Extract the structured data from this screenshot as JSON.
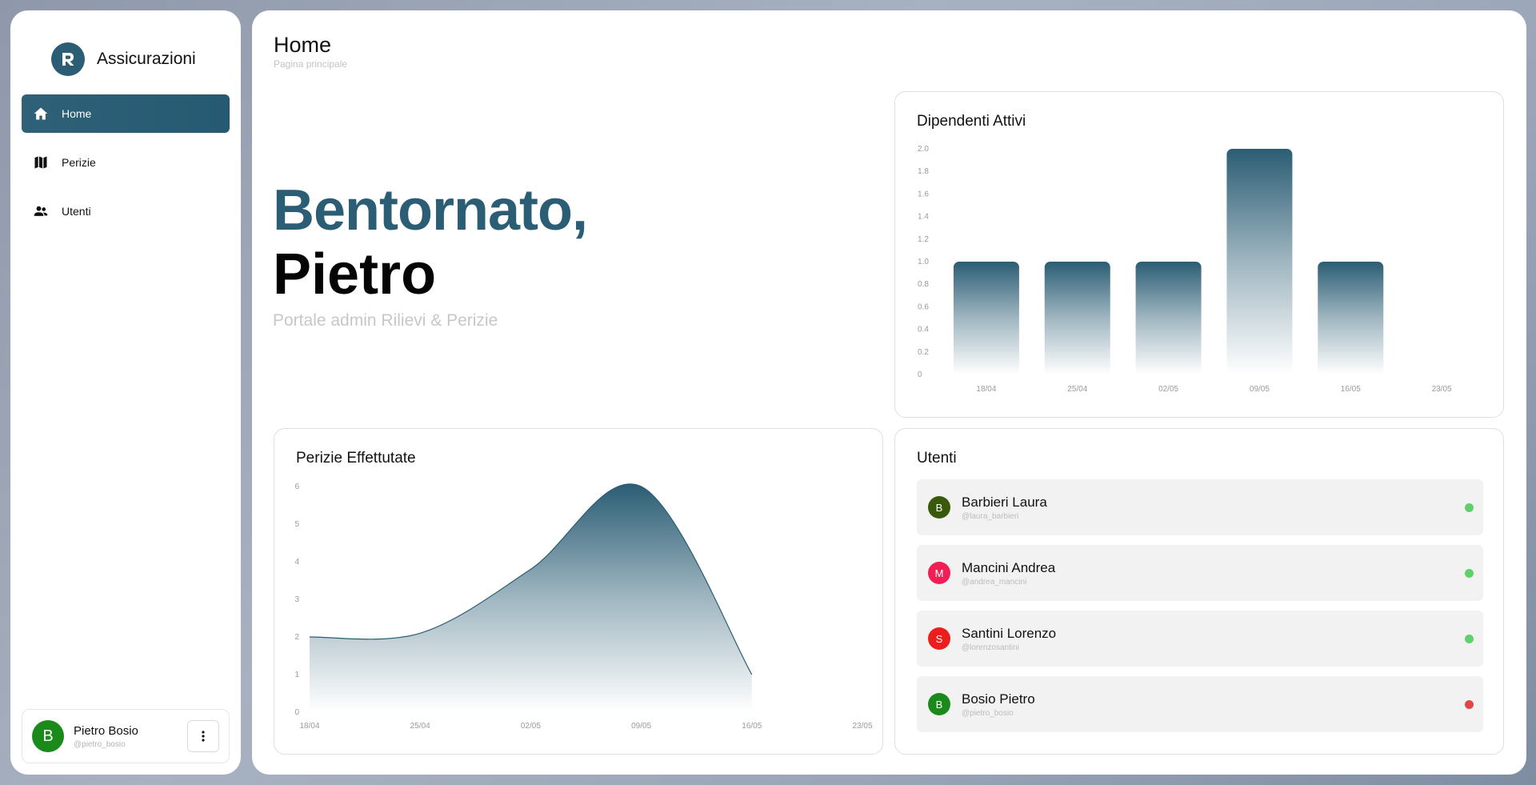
{
  "app": {
    "name": "Assicurazioni"
  },
  "sidebar": {
    "items": [
      {
        "label": "Home",
        "icon": "home-icon",
        "active": true
      },
      {
        "label": "Perizie",
        "icon": "map-icon",
        "active": false
      },
      {
        "label": "Utenti",
        "icon": "users-icon",
        "active": false
      }
    ],
    "profile": {
      "initial": "B",
      "name": "Pietro Bosio",
      "handle": "@pietro_bosio",
      "avatar_color": "#1a8a1a"
    }
  },
  "header": {
    "title": "Home",
    "subtitle": "Pagina principale"
  },
  "welcome": {
    "line1": "Bentornato,",
    "line2": "Pietro",
    "subtitle": "Portale admin Rilievi & Perizie"
  },
  "colors": {
    "accent": "#2b5d74",
    "online": "#5fd16a",
    "offline": "#e04848"
  },
  "chart_data": [
    {
      "type": "bar",
      "title": "Dipendenti Attivi",
      "categories": [
        "18/04",
        "25/04",
        "02/05",
        "09/05",
        "16/05",
        "23/05"
      ],
      "values": [
        1,
        1,
        1,
        2,
        1,
        0
      ],
      "ylim": [
        0,
        2
      ],
      "yticks": [
        "0",
        "0.2",
        "0.4",
        "0.6",
        "0.8",
        "1.0",
        "1.2",
        "1.4",
        "1.6",
        "1.8",
        "2.0"
      ],
      "grid": false
    },
    {
      "type": "area",
      "title": "Perizie Effettutate",
      "x": [
        "18/04",
        "25/04",
        "02/05",
        "09/05",
        "16/05",
        "23/05"
      ],
      "values": [
        2,
        2.1,
        3.8,
        6,
        1,
        null
      ],
      "ylim": [
        0,
        6
      ],
      "yticks": [
        "0",
        "1",
        "2",
        "3",
        "4",
        "5",
        "6"
      ],
      "grid": false
    }
  ],
  "users": {
    "title": "Utenti",
    "items": [
      {
        "initial": "B",
        "name": "Barbieri Laura",
        "handle": "@laura_barbieri",
        "avatar_color": "#3a5a0b",
        "online": true
      },
      {
        "initial": "M",
        "name": "Mancini Andrea",
        "handle": "@andrea_mancini",
        "avatar_color": "#ef1f55",
        "online": true
      },
      {
        "initial": "S",
        "name": "Santini Lorenzo",
        "handle": "@lorenzosantini",
        "avatar_color": "#ee1d1d",
        "online": true
      },
      {
        "initial": "B",
        "name": "Bosio Pietro",
        "handle": "@pietro_bosio",
        "avatar_color": "#1a8a1a",
        "online": false
      }
    ]
  }
}
